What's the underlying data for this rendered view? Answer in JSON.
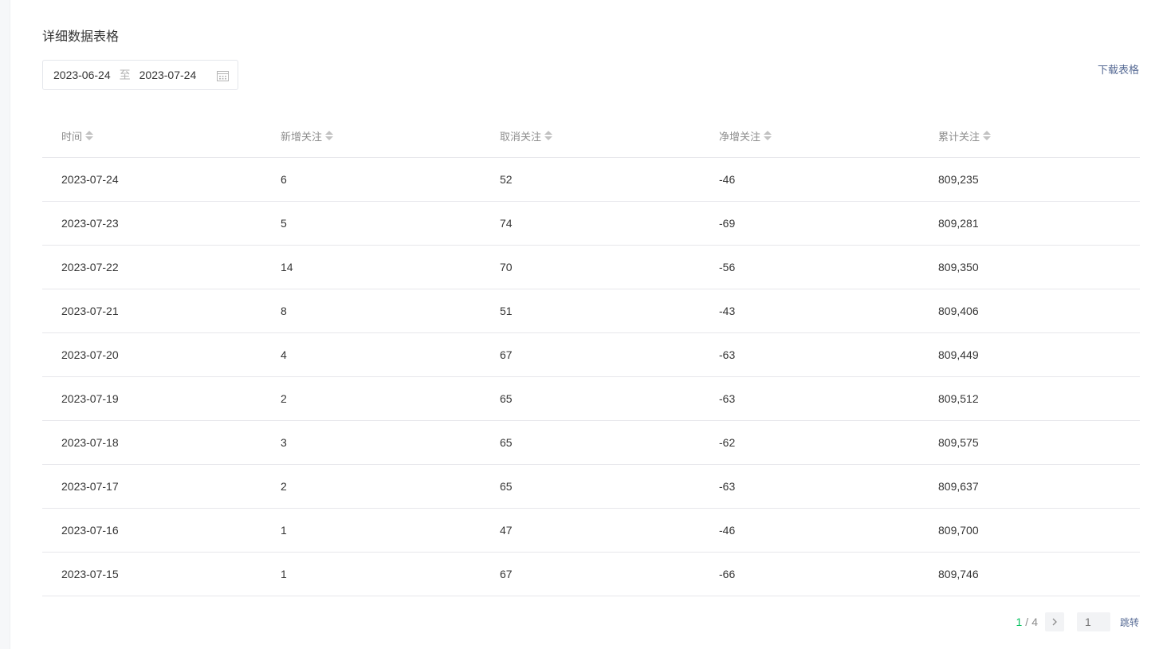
{
  "section_title": "详细数据表格",
  "date_range": {
    "start": "2023-06-24",
    "separator": "至",
    "end": "2023-07-24"
  },
  "download_label": "下载表格",
  "table": {
    "headers": [
      "时间",
      "新增关注",
      "取消关注",
      "净增关注",
      "累计关注"
    ],
    "rows": [
      [
        "2023-07-24",
        "6",
        "52",
        "-46",
        "809,235"
      ],
      [
        "2023-07-23",
        "5",
        "74",
        "-69",
        "809,281"
      ],
      [
        "2023-07-22",
        "14",
        "70",
        "-56",
        "809,350"
      ],
      [
        "2023-07-21",
        "8",
        "51",
        "-43",
        "809,406"
      ],
      [
        "2023-07-20",
        "4",
        "67",
        "-63",
        "809,449"
      ],
      [
        "2023-07-19",
        "2",
        "65",
        "-63",
        "809,512"
      ],
      [
        "2023-07-18",
        "3",
        "65",
        "-62",
        "809,575"
      ],
      [
        "2023-07-17",
        "2",
        "65",
        "-63",
        "809,637"
      ],
      [
        "2023-07-16",
        "1",
        "47",
        "-46",
        "809,700"
      ],
      [
        "2023-07-15",
        "1",
        "67",
        "-66",
        "809,746"
      ]
    ]
  },
  "pagination": {
    "current": "1",
    "separator": "/",
    "total": "4",
    "input_placeholder": "1",
    "jump_label": "跳转"
  },
  "colors": {
    "accent_green": "#07c160",
    "link_blue": "#576b95"
  },
  "icons": {
    "date_picker": "calendar-icon",
    "sort": "sort-icon",
    "next": "chevron-right-icon"
  }
}
